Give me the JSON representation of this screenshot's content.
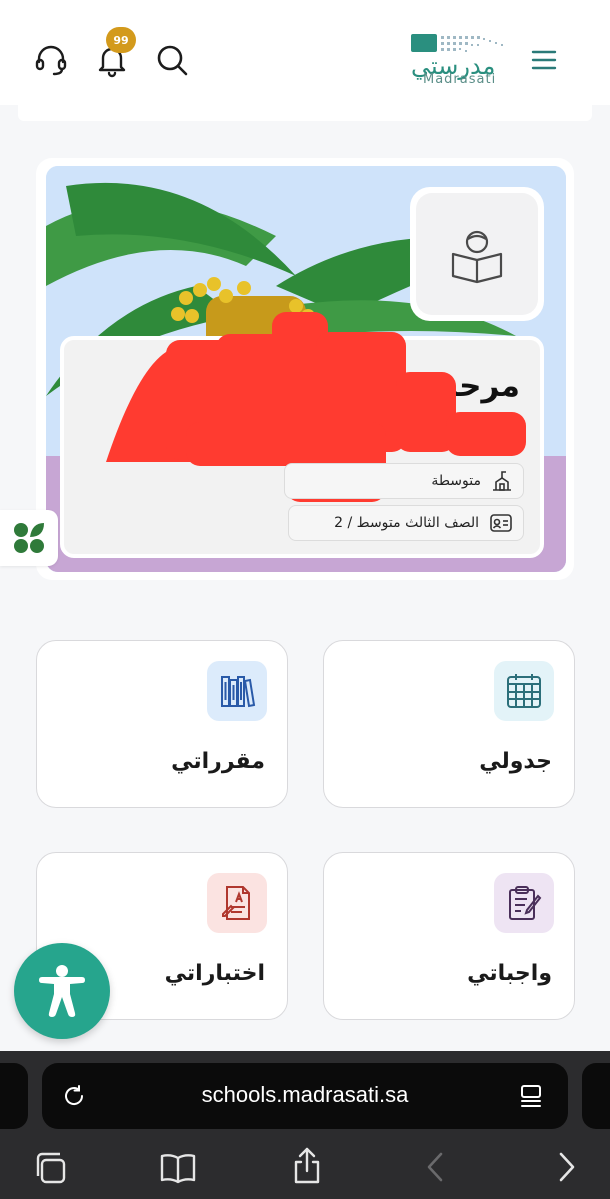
{
  "header": {
    "logo_ar": "مدرستي",
    "logo_en": "Madrasati",
    "notification_count": "99",
    "icons": [
      "headset-icon",
      "bell-icon",
      "search-icon",
      "hamburger-menu-icon"
    ]
  },
  "hero": {
    "welcome": "مرحبا بك",
    "school_level": "متوسطة",
    "class_label": "الصف الثالث متوسط / 2"
  },
  "tiles": [
    {
      "id": "schedule",
      "label": "جدولي",
      "icon": "calendar-icon",
      "bg": "#e3f3f8"
    },
    {
      "id": "courses",
      "label": "مقرراتي",
      "icon": "books-icon",
      "bg": "#dcebfb"
    },
    {
      "id": "assignments",
      "label": "واجباتي",
      "icon": "clipboard-icon",
      "bg": "#eee4f3"
    },
    {
      "id": "exams",
      "label": "اختباراتي",
      "icon": "exam-paper-icon",
      "bg": "#fbe3e1"
    }
  ],
  "browser": {
    "url": "schools.madrasati.sa"
  },
  "colors": {
    "brand": "#2a8f7f",
    "badge": "#d39a1c",
    "fab": "#26a58d"
  }
}
